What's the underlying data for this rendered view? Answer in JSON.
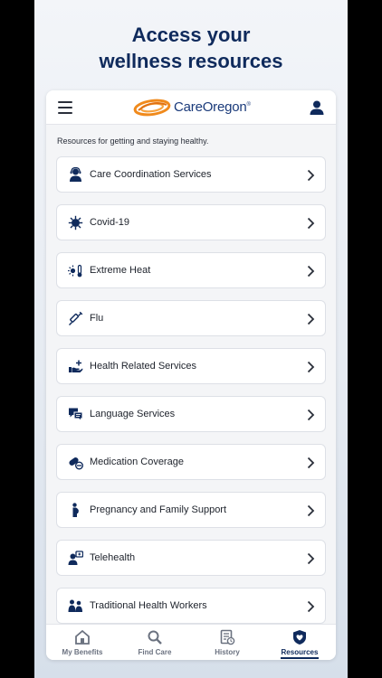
{
  "promo": {
    "line1": "Access your",
    "line2": "wellness resources"
  },
  "header": {
    "brand": "CareOregon",
    "brand_mark": "®"
  },
  "intro": "Resources for getting and staying healthy.",
  "resources": [
    {
      "label": "Care Coordination Services",
      "icon": "care-coordinator-icon"
    },
    {
      "label": "Covid-19",
      "icon": "virus-icon"
    },
    {
      "label": "Extreme Heat",
      "icon": "sun-thermometer-icon"
    },
    {
      "label": "Flu",
      "icon": "syringe-icon"
    },
    {
      "label": "Health Related Services",
      "icon": "hand-plus-icon"
    },
    {
      "label": "Language Services",
      "icon": "chat-bubbles-icon"
    },
    {
      "label": "Medication Coverage",
      "icon": "pill-icon"
    },
    {
      "label": "Pregnancy and Family Support",
      "icon": "pregnancy-icon"
    },
    {
      "label": "Telehealth",
      "icon": "telehealth-icon"
    },
    {
      "label": "Traditional Health Workers",
      "icon": "health-worker-icon"
    }
  ],
  "tabs": [
    {
      "label": "My Benefits",
      "icon": "home-icon"
    },
    {
      "label": "Find Care",
      "icon": "search-icon"
    },
    {
      "label": "History",
      "icon": "history-icon"
    },
    {
      "label": "Resources",
      "icon": "shield-icon",
      "active": true
    }
  ],
  "colors": {
    "brand_navy": "#0f2a5c",
    "logo_orange": "#f08a1c",
    "text": "#1d222b"
  }
}
